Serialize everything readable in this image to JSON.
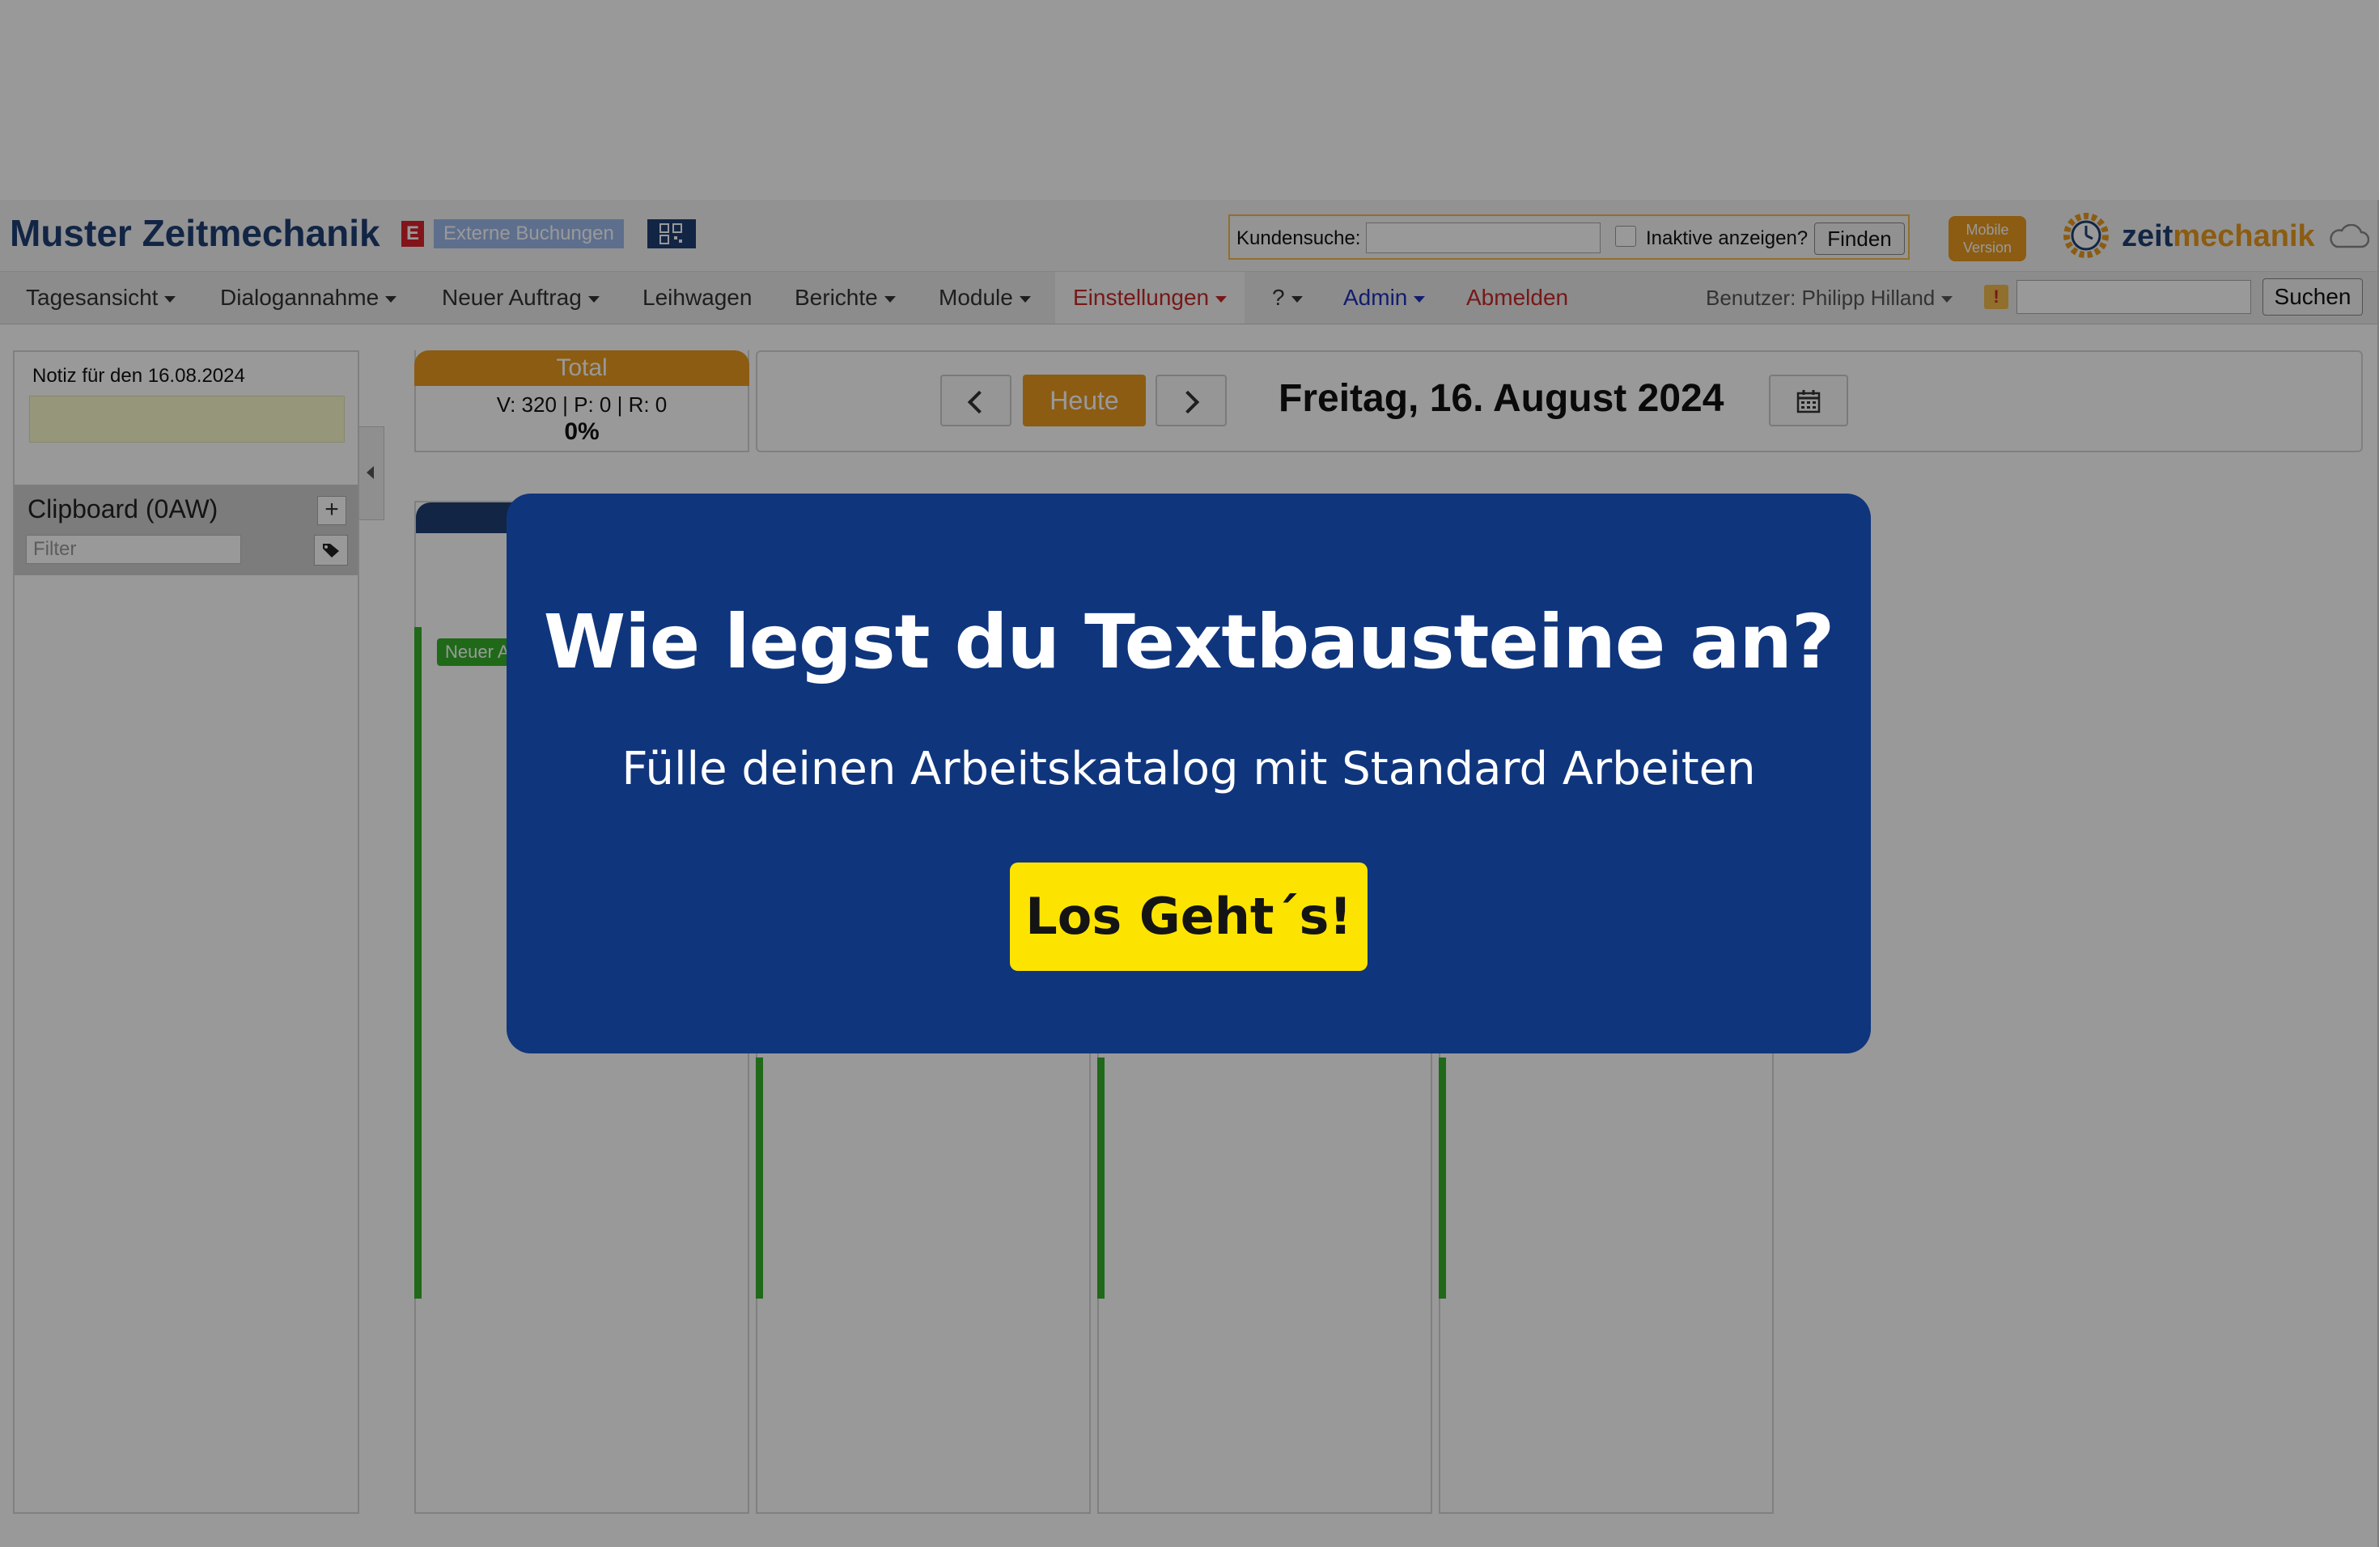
{
  "header": {
    "brand": "Muster Zeitmechanik",
    "brand_badge": "E",
    "external_bookings": "Externe Buchungen",
    "customer_search_label": "Kundensuche:",
    "show_inactive_label": "Inaktive anzeigen?",
    "find_button": "Finden",
    "mobile_version": "Mobile Version",
    "logo_prefix": "zeit",
    "logo_suffix": "mechanik"
  },
  "nav": {
    "items": [
      "Tagesansicht",
      "Dialogannahme",
      "Neuer Auftrag",
      "Leihwagen",
      "Berichte",
      "Module",
      "Einstellungen",
      "?",
      "Admin",
      "Abmelden"
    ],
    "user": "Benutzer: Philipp Hilland",
    "warn": "!",
    "search_button": "Suchen"
  },
  "sidebar": {
    "note_title": "Notiz für den 16.08.2024",
    "clipboard_title": "Clipboard (0AW)",
    "filter_placeholder": "Filter"
  },
  "total": {
    "title": "Total",
    "stats": "V: 320 | P: 0 | R: 0",
    "percent": "0%"
  },
  "datebar": {
    "today_button": "Heute",
    "date": "Freitag, 16. August 2024"
  },
  "columns": {
    "new_order_badge": "Neuer A"
  },
  "modal": {
    "title": "Wie legst du Textbausteine an?",
    "subtitle": "Fülle deinen Arbeitskatalog mit Standard Arbeiten",
    "cta": "Los Geht´s!"
  },
  "colors": {
    "brand_blue": "#1e3f73",
    "accent_orange": "#e89a1f",
    "modal_blue": "#0f357d",
    "cta_yellow": "#fde400",
    "status_green": "#35b02a"
  }
}
